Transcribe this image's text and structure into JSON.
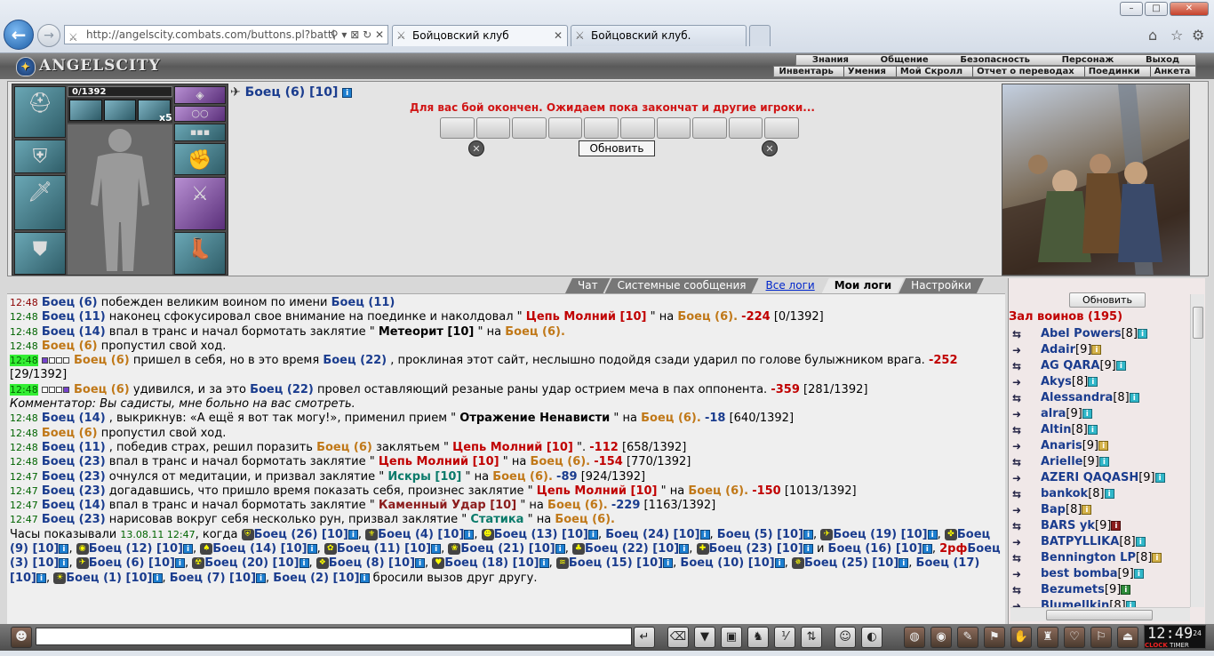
{
  "browser": {
    "url": "http://angelscity.combats.com/buttons.pl?battl",
    "tabs": [
      {
        "title": "Бойцовский клуб"
      },
      {
        "title": "Бойцовский клуб."
      }
    ]
  },
  "header": {
    "logo": "ANGELSCITY",
    "menu_top": [
      "Знания",
      "Общение",
      "Безопасность",
      "Персонаж",
      "Выход"
    ],
    "menu_bottom": [
      "Инвентарь",
      "Умения",
      "Мой Скролл",
      "Отчет о переводах",
      "Поединки",
      "Анкета"
    ]
  },
  "character": {
    "hp": "0/1392",
    "stack": "x5"
  },
  "battle": {
    "fighter_name": "Боец (6) [10]",
    "message": "Для вас бой окончен. Ожидаем пока закончат и другие игроки...",
    "refresh_label": "Обновить"
  },
  "log_tabs": [
    {
      "label": "Чат"
    },
    {
      "label": "Системные сообщения"
    },
    {
      "label": "Все логи"
    },
    {
      "label": "Мои логи"
    },
    {
      "label": "Настройки"
    }
  ],
  "log": [
    {
      "time": "12:48",
      "parts": [
        [
          "n1",
          "Боец (6)"
        ],
        [
          "",
          "побежден великим воином по имени"
        ],
        [
          "n1",
          "Боец (11)"
        ]
      ]
    },
    {
      "time": "12:48",
      "parts": [
        [
          "n1",
          "Боец (11)"
        ],
        [
          "",
          "наконец сфокусировал свое внимание на поединке и наколдовал \""
        ],
        [
          "sp",
          "Цепь Молний [10]"
        ],
        [
          "",
          "\" на"
        ],
        [
          "n2",
          "Боец (6)."
        ],
        [
          "dmg",
          "-224"
        ],
        [
          "",
          "[0/1392]"
        ]
      ]
    },
    {
      "time": "12:48",
      "parts": [
        [
          "n1",
          "Боец (14)"
        ],
        [
          "",
          "впал в транс и начал бормотать заклятие \""
        ],
        [
          "sps",
          "Метеорит [10]"
        ],
        [
          "",
          "\" на"
        ],
        [
          "n2",
          "Боец (6)."
        ]
      ]
    },
    {
      "time": "12:48",
      "parts": [
        [
          "n2",
          "Боец (6)"
        ],
        [
          "",
          "пропустил свой ход."
        ]
      ]
    },
    {
      "time": "12:48",
      "hl": true,
      "boxes": "1000",
      "parts": [
        [
          "n2",
          "Боец (6)"
        ],
        [
          "",
          "пришел в себя, но в это время"
        ],
        [
          "n1",
          "Боец (22)"
        ],
        [
          "",
          ", проклиная этот сайт, неслышно подойдя сзади ударил по голове булыжником врага."
        ],
        [
          "dmg",
          "-252"
        ]
      ]
    },
    {
      "time": "",
      "parts": [
        [
          "",
          "[29/1392]"
        ]
      ]
    },
    {
      "time": "12:48",
      "hl": true,
      "boxes": "0001",
      "parts": [
        [
          "n2",
          "Боец (6)"
        ],
        [
          "",
          "удивился, и за это"
        ],
        [
          "n1",
          "Боец (22)"
        ],
        [
          "",
          "провел оставляющий резаные раны удар острием меча в пах оппонента."
        ],
        [
          "dmg",
          "-359"
        ],
        [
          "",
          "[281/1392]"
        ]
      ]
    },
    {
      "time": "",
      "parts": [
        [
          "it",
          "Комментатор: Вы садисты, мне больно на вас смотреть."
        ]
      ]
    },
    {
      "time": "12:48",
      "parts": [
        [
          "n1",
          "Боец (14)"
        ],
        [
          "",
          ", выкрикнув: «А ещё я вот так могу!», применил прием \""
        ],
        [
          "sps",
          "Отражение Ненависти"
        ],
        [
          "",
          "\" на"
        ],
        [
          "n2",
          "Боец (6)."
        ],
        [
          "dmgb",
          "-18"
        ],
        [
          "",
          "[640/1392]"
        ]
      ]
    },
    {
      "time": "12:48",
      "parts": [
        [
          "n2",
          "Боец (6)"
        ],
        [
          "",
          "пропустил свой ход."
        ]
      ]
    },
    {
      "time": "12:48",
      "parts": [
        [
          "n1",
          "Боец (11)"
        ],
        [
          "",
          ", победив страх, решил поразить"
        ],
        [
          "n2",
          "Боец (6)"
        ],
        [
          "",
          "заклятьем \""
        ],
        [
          "sp",
          "Цепь Молний [10]"
        ],
        [
          "",
          "\"."
        ],
        [
          "dmg",
          "-112"
        ],
        [
          "",
          "[658/1392]"
        ]
      ]
    },
    {
      "time": "12:48",
      "parts": [
        [
          "n1",
          "Боец (23)"
        ],
        [
          "",
          "впал в транс и начал бормотать заклятие \""
        ],
        [
          "sp",
          "Цепь Молний [10]"
        ],
        [
          "",
          "\" на"
        ],
        [
          "n2",
          "Боец (6)."
        ],
        [
          "dmg",
          "-154"
        ],
        [
          "",
          "[770/1392]"
        ]
      ]
    },
    {
      "time": "12:47",
      "parts": [
        [
          "n1",
          "Боец (23)"
        ],
        [
          "",
          "очнулся от медитации, и призвал заклятие \""
        ],
        [
          "spg",
          "Искры [10]"
        ],
        [
          "",
          "\" на"
        ],
        [
          "n2",
          "Боец (6)."
        ],
        [
          "dmgb",
          "-89"
        ],
        [
          "",
          "[924/1392]"
        ]
      ]
    },
    {
      "time": "12:47",
      "parts": [
        [
          "n1",
          "Боец (23)"
        ],
        [
          "",
          "догадавшись, что пришло время показать себя, произнес заклятие \""
        ],
        [
          "sp",
          "Цепь Молний [10]"
        ],
        [
          "",
          "\" на"
        ],
        [
          "n2",
          "Боец (6)."
        ],
        [
          "dmg",
          "-150"
        ],
        [
          "",
          "[1013/1392]"
        ]
      ]
    },
    {
      "time": "12:47",
      "parts": [
        [
          "n1",
          "Боец (14)"
        ],
        [
          "",
          "впал в транс и начал бормотать заклятие \""
        ],
        [
          "sp2",
          "Каменный Удар [10]"
        ],
        [
          "",
          "\" на"
        ],
        [
          "n2",
          "Боец (6)."
        ],
        [
          "dmgb",
          "-229"
        ],
        [
          "",
          "[1163/1392]"
        ]
      ]
    },
    {
      "time": "12:47",
      "parts": [
        [
          "n1",
          "Боец (23)"
        ],
        [
          "",
          "нарисовав вокруг себя несколько рун, призвал заклятие \""
        ],
        [
          "spg",
          "Статика"
        ],
        [
          "",
          "\" на"
        ],
        [
          "n2",
          "Боец (6)."
        ]
      ]
    }
  ],
  "start_text": {
    "prefix": "Часы показывали",
    "date": "13.08.11 12:47",
    "when": ", когда",
    "fighters": [
      "Боец (26) [10]",
      "Боец (4) [10]",
      "Боец (13) [10]",
      "Боец (24) [10]",
      "Боец (5) [10]",
      "Боец (19) [10]",
      "Боец (9) [10]",
      "Боец (12) [10]",
      "Боец (14) [10]",
      "Боец (11) [10]",
      "Боец (21) [10]",
      "Боец (22) [10]",
      "Боец (23) [10]",
      "Боец (16) [10]",
      "Боец (3) [10]",
      "Боец (6) [10]",
      "Боец (20) [10]",
      "Боец (8) [10]",
      "Боец (18) [10]",
      "Боец (15) [10]",
      "Боец (10) [10]",
      "Боец (25) [10]",
      "Боец (17) [10]",
      "Боец (1) [10]",
      "Боец (7) [10]",
      "Боец (2) [10]"
    ],
    "and": "и",
    "suffix": "бросили вызов друг другу.",
    "badge": "2рф"
  },
  "side": {
    "refresh_label": "Обновить",
    "title": "Зал воинов (195)",
    "players": [
      {
        "name": "Abel Powers",
        "level": "[8]",
        "info": "t"
      },
      {
        "name": "Adair",
        "level": "[9]",
        "info": "y"
      },
      {
        "name": "AG QARA",
        "level": "[9]",
        "info": "t"
      },
      {
        "name": "Akys",
        "level": "[8]",
        "info": "t"
      },
      {
        "name": "Alessandra",
        "level": "[8]",
        "info": "t"
      },
      {
        "name": "alra",
        "level": "[9]",
        "info": "t"
      },
      {
        "name": "Altin",
        "level": "[8]",
        "info": "t"
      },
      {
        "name": "Anaris",
        "level": "[9]",
        "info": "y"
      },
      {
        "name": "Arielle",
        "level": "[9]",
        "info": "t"
      },
      {
        "name": "AZERI QAQASH",
        "level": "[9]",
        "info": "t"
      },
      {
        "name": "bankok",
        "level": "[8]",
        "info": "t"
      },
      {
        "name": "Bap",
        "level": "[8]",
        "info": "y"
      },
      {
        "name": "BARS yk",
        "level": "[9]",
        "info": "r"
      },
      {
        "name": "BATPYLLIKA",
        "level": "[8]",
        "info": "t"
      },
      {
        "name": "Bennington LP",
        "level": "[8]",
        "info": "y"
      },
      {
        "name": "best bomba",
        "level": "[9]",
        "info": "t"
      },
      {
        "name": "Bezumets",
        "level": "[9]",
        "info": "g"
      },
      {
        "name": "Blumellkin",
        "level": "[8]",
        "info": "t"
      }
    ]
  },
  "clock": {
    "time": "12:49",
    "seconds": "24",
    "label1": "CLOCK",
    "label2": "TIMER"
  }
}
